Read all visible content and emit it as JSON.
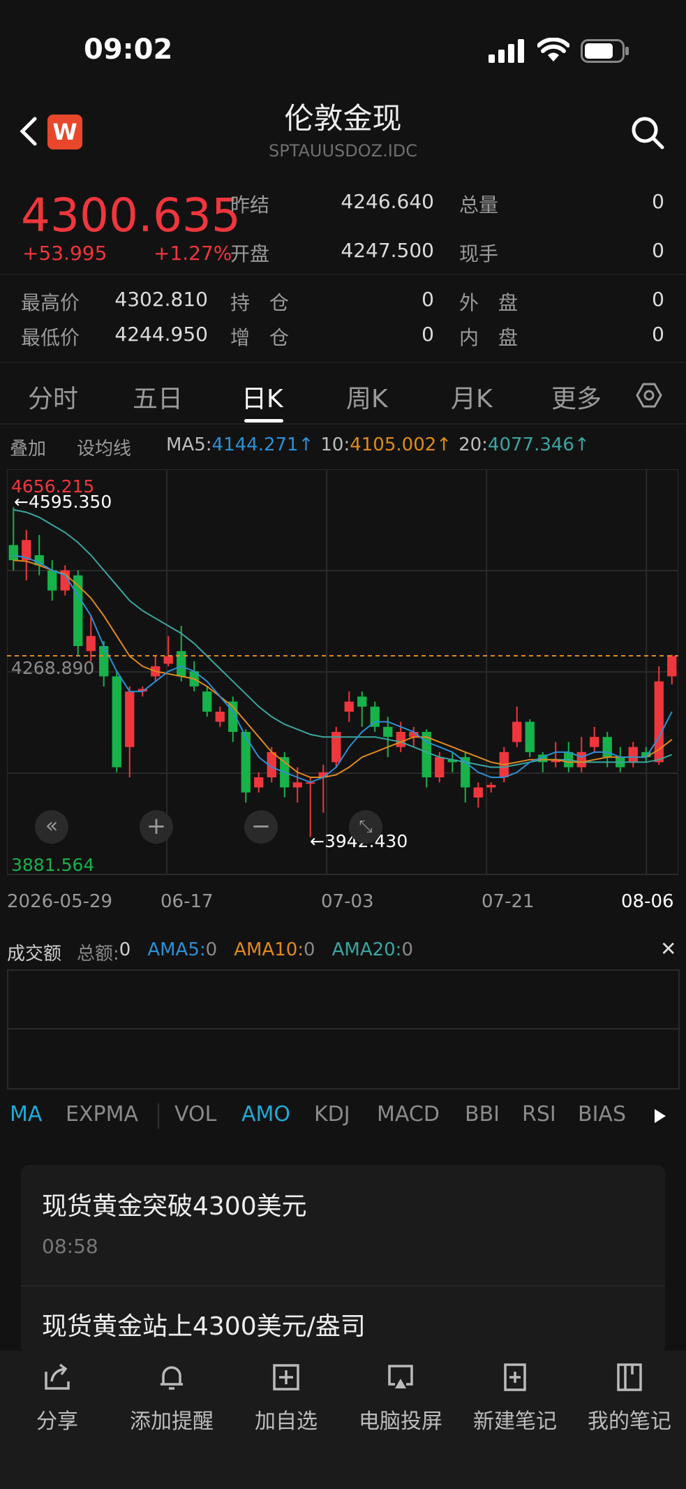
{
  "status": {
    "time": "09:02"
  },
  "header": {
    "title": "伦敦金现",
    "subtitle": "SPTAUUSDOZ.IDC",
    "logo": "W"
  },
  "quote": {
    "price": "4300.635",
    "change": "+53.995",
    "change_pct": "+1.27%",
    "prev_settle_label": "昨结",
    "prev_settle": "4246.640",
    "total_vol_label": "总量",
    "total_vol": "0",
    "open_label": "开盘",
    "open": "4247.500",
    "current_hand_label": "现手",
    "current_hand": "0",
    "high_label": "最高价",
    "high": "4302.810",
    "position_label": "持　仓",
    "position": "0",
    "outer_label": "外　盘",
    "outer": "0",
    "low_label": "最低价",
    "low": "4244.950",
    "add_pos_label": "增　仓",
    "add_pos": "0",
    "inner_label": "内　盘",
    "inner": "0"
  },
  "tabs": [
    "分时",
    "五日",
    "日K",
    "周K",
    "月K",
    "更多"
  ],
  "ma_row": {
    "overlay": "叠加",
    "set_ma": "设均线",
    "ma5_label": "MA5:",
    "ma5": "4144.271↑",
    "ma10_label": "10:",
    "ma10": "4105.002↑",
    "ma20_label": "20:",
    "ma20": "4077.346↑"
  },
  "chart_data": {
    "type": "candlestick",
    "y_max_label": "4656.215",
    "y_min_label": "3881.564",
    "y_mid_label": "4268.890",
    "high_marker": "←4595.350",
    "low_marker": "←3942.430",
    "ylim": [
      3881.564,
      4656.215
    ],
    "current_line": 4300.635,
    "x_labels": [
      "2026-05-29",
      "06-17",
      "07-03",
      "07-21",
      "08-06"
    ],
    "candles": [
      {
        "o": 4520,
        "c": 4490,
        "h": 4595,
        "l": 4470
      },
      {
        "o": 4490,
        "c": 4530,
        "h": 4550,
        "l": 4450
      },
      {
        "o": 4500,
        "c": 4480,
        "h": 4540,
        "l": 4460
      },
      {
        "o": 4470,
        "c": 4430,
        "h": 4490,
        "l": 4410
      },
      {
        "o": 4430,
        "c": 4470,
        "h": 4480,
        "l": 4420
      },
      {
        "o": 4460,
        "c": 4320,
        "h": 4470,
        "l": 4300
      },
      {
        "o": 4310,
        "c": 4340,
        "h": 4380,
        "l": 4290
      },
      {
        "o": 4320,
        "c": 4260,
        "h": 4330,
        "l": 4240
      },
      {
        "o": 4260,
        "c": 4080,
        "h": 4270,
        "l": 4070
      },
      {
        "o": 4120,
        "c": 4230,
        "h": 4240,
        "l": 4060
      },
      {
        "o": 4230,
        "c": 4235,
        "h": 4240,
        "l": 4220
      },
      {
        "o": 4260,
        "c": 4280,
        "h": 4300,
        "l": 4250
      },
      {
        "o": 4285,
        "c": 4300,
        "h": 4340,
        "l": 4280
      },
      {
        "o": 4310,
        "c": 4260,
        "h": 4360,
        "l": 4250
      },
      {
        "o": 4270,
        "c": 4240,
        "h": 4290,
        "l": 4230
      },
      {
        "o": 4230,
        "c": 4190,
        "h": 4240,
        "l": 4180
      },
      {
        "o": 4170,
        "c": 4190,
        "h": 4200,
        "l": 4160
      },
      {
        "o": 4210,
        "c": 4150,
        "h": 4220,
        "l": 4130
      },
      {
        "o": 4150,
        "c": 4030,
        "h": 4155,
        "l": 4010
      },
      {
        "o": 4040,
        "c": 4060,
        "h": 4070,
        "l": 4030
      },
      {
        "o": 4060,
        "c": 4110,
        "h": 4120,
        "l": 4050
      },
      {
        "o": 4100,
        "c": 4040,
        "h": 4110,
        "l": 4020
      },
      {
        "o": 4040,
        "c": 4050,
        "h": 4080,
        "l": 4010
      },
      {
        "o": 4050,
        "c": 4050,
        "h": 4060,
        "l": 3942
      },
      {
        "o": 4060,
        "c": 4070,
        "h": 4085,
        "l": 3990
      },
      {
        "o": 4090,
        "c": 4150,
        "h": 4160,
        "l": 4080
      },
      {
        "o": 4190,
        "c": 4210,
        "h": 4230,
        "l": 4170
      },
      {
        "o": 4220,
        "c": 4200,
        "h": 4230,
        "l": 4160
      },
      {
        "o": 4200,
        "c": 4160,
        "h": 4210,
        "l": 4150
      },
      {
        "o": 4160,
        "c": 4140,
        "h": 4180,
        "l": 4100
      },
      {
        "o": 4120,
        "c": 4150,
        "h": 4170,
        "l": 4110
      },
      {
        "o": 4140,
        "c": 4150,
        "h": 4160,
        "l": 4120
      },
      {
        "o": 4150,
        "c": 4060,
        "h": 4155,
        "l": 4040
      },
      {
        "o": 4060,
        "c": 4100,
        "h": 4110,
        "l": 4050
      },
      {
        "o": 4095,
        "c": 4090,
        "h": 4110,
        "l": 4070
      },
      {
        "o": 4100,
        "c": 4040,
        "h": 4110,
        "l": 4010
      },
      {
        "o": 4020,
        "c": 4040,
        "h": 4050,
        "l": 4000
      },
      {
        "o": 4040,
        "c": 4045,
        "h": 4050,
        "l": 4030
      },
      {
        "o": 4060,
        "c": 4110,
        "h": 4120,
        "l": 4050
      },
      {
        "o": 4130,
        "c": 4170,
        "h": 4200,
        "l": 4120
      },
      {
        "o": 4170,
        "c": 4110,
        "h": 4175,
        "l": 4100
      },
      {
        "o": 4105,
        "c": 4090,
        "h": 4110,
        "l": 4070
      },
      {
        "o": 4090,
        "c": 4095,
        "h": 4130,
        "l": 4080
      },
      {
        "o": 4110,
        "c": 4080,
        "h": 4130,
        "l": 4070
      },
      {
        "o": 4080,
        "c": 4110,
        "h": 4140,
        "l": 4070
      },
      {
        "o": 4120,
        "c": 4140,
        "h": 4160,
        "l": 4110
      },
      {
        "o": 4140,
        "c": 4100,
        "h": 4150,
        "l": 4080
      },
      {
        "o": 4100,
        "c": 4080,
        "h": 4120,
        "l": 4070
      },
      {
        "o": 4090,
        "c": 4120,
        "h": 4130,
        "l": 4080
      },
      {
        "o": 4110,
        "c": 4100,
        "h": 4120,
        "l": 4090
      },
      {
        "o": 4090,
        "c": 4250,
        "h": 4280,
        "l": 4085
      },
      {
        "o": 4260,
        "c": 4300,
        "h": 4303,
        "l": 4244
      }
    ],
    "ma5": [
      4500,
      4495,
      4485,
      4470,
      4460,
      4420,
      4380,
      4320,
      4270,
      4230,
      4230,
      4250,
      4270,
      4280,
      4270,
      4250,
      4220,
      4190,
      4140,
      4100,
      4080,
      4070,
      4060,
      4050,
      4060,
      4080,
      4120,
      4150,
      4170,
      4170,
      4160,
      4150,
      4130,
      4120,
      4110,
      4090,
      4070,
      4060,
      4060,
      4070,
      4090,
      4100,
      4110,
      4110,
      4100,
      4110,
      4110,
      4100,
      4100,
      4100,
      4140,
      4190
    ],
    "ma10": [
      4490,
      4488,
      4480,
      4470,
      4462,
      4440,
      4415,
      4380,
      4340,
      4300,
      4280,
      4270,
      4265,
      4260,
      4255,
      4240,
      4220,
      4200,
      4170,
      4140,
      4110,
      4090,
      4070,
      4060,
      4060,
      4065,
      4080,
      4100,
      4110,
      4120,
      4130,
      4140,
      4140,
      4130,
      4120,
      4110,
      4100,
      4090,
      4085,
      4090,
      4095,
      4095,
      4095,
      4090,
      4090,
      4095,
      4100,
      4100,
      4100,
      4100,
      4115,
      4135
    ],
    "ma20": [
      4590,
      4585,
      4575,
      4560,
      4545,
      4525,
      4500,
      4470,
      4440,
      4410,
      4390,
      4375,
      4360,
      4345,
      4325,
      4300,
      4275,
      4250,
      4225,
      4200,
      4180,
      4165,
      4155,
      4145,
      4140,
      4140,
      4140,
      4140,
      4140,
      4135,
      4130,
      4120,
      4110,
      4100,
      4095,
      4090,
      4085,
      4080,
      4080,
      4085,
      4090,
      4095,
      4095,
      4095,
      4090,
      4090,
      4090,
      4090,
      4090,
      4090,
      4095,
      4105
    ]
  },
  "volume": {
    "label": "成交额",
    "total_label": "总额:",
    "total": "0",
    "ama5_label": "AMA5:",
    "ama5": "0",
    "ama10_label": "AMA10:",
    "ama10": "0",
    "ama20_label": "AMA20:",
    "ama20": "0",
    "close": "✕"
  },
  "indicator_tabs": [
    "MA",
    "EXPMA",
    "VOL",
    "AMO",
    "KDJ",
    "MACD",
    "BBI",
    "RSI",
    "BIAS"
  ],
  "news": [
    {
      "title": "现货黄金突破4300美元",
      "time": "08:58"
    },
    {
      "title": "现货黄金站上4300美元/盎司"
    }
  ],
  "bottom_bar": [
    "分享",
    "添加提醒",
    "加自选",
    "电脑投屏",
    "新建笔记",
    "我的笔记"
  ],
  "colors": {
    "up": "#f0363d",
    "down": "#17b24a",
    "ma5": "#2d8fd5",
    "ma10": "#e08a1e",
    "ma20": "#3aa6a0",
    "accent": "#1eaad8"
  }
}
